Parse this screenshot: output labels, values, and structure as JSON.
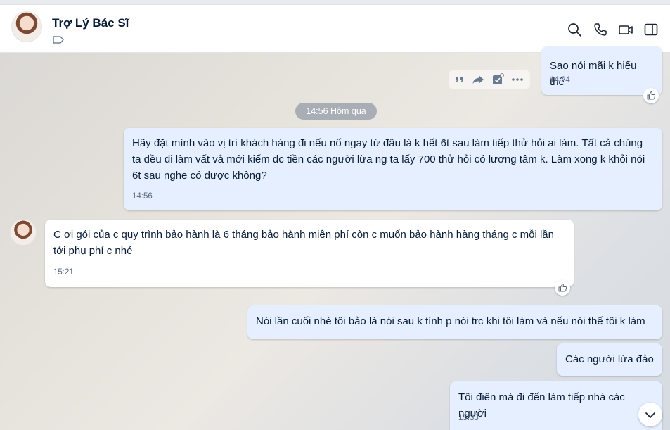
{
  "header": {
    "contact_name": "Trợ Lý Bác Sĩ"
  },
  "messages": [
    {
      "direction": "out",
      "text": "Sao nói mãi k hiểu thế",
      "time": "14:24"
    },
    {
      "direction": "out",
      "text": "Hãy đặt mình vào vị trí khách hàng đi nếu nố ngay từ đâu là k hết 6t sau làm tiếp thử hỏi ai làm. Tất cả chúng ta đều đi làm vất vả mới kiếm dc tiền các người lừa ng ta lấy 700 thử hỏi có lương tâm k. Làm xong k khỏi nói 6t sau nghe có được không?",
      "time": "14:56"
    },
    {
      "direction": "in",
      "text": "C ơi gói của c quy trình bảo hành là 6 tháng bảo hành miễn phí còn c muốn bảo hành hàng tháng c mỗi lần tới phụ phí c nhé",
      "time": "15:21"
    },
    {
      "direction": "out",
      "text": "Nói lần cuối nhé tôi bảo là nói sau k tính p nói trc khi tôi làm và nếu nói thế tôi k làm"
    },
    {
      "direction": "out",
      "text": "Các người lừa đảo"
    },
    {
      "direction": "out",
      "text": "Tôi điên mà đi đến làm tiếp nhà các người",
      "time": "15:33"
    }
  ],
  "date_separator": "14:56 Hôm qua",
  "icons": {
    "header": [
      "search-icon",
      "phone-icon",
      "video-call-icon",
      "sidebar-toggle-icon",
      "tag-icon"
    ],
    "toolbar": [
      "quote-icon",
      "forward-icon",
      "task-icon",
      "more-icon"
    ],
    "reaction": "thumbs-up-icon",
    "scroll": "chevron-down-icon"
  },
  "colors": {
    "outgoing_bubble": "#e5efff",
    "incoming_bubble": "#ffffff",
    "text": "#081c36",
    "time": "#5a6981",
    "date_chip": "#a9aeb5"
  }
}
